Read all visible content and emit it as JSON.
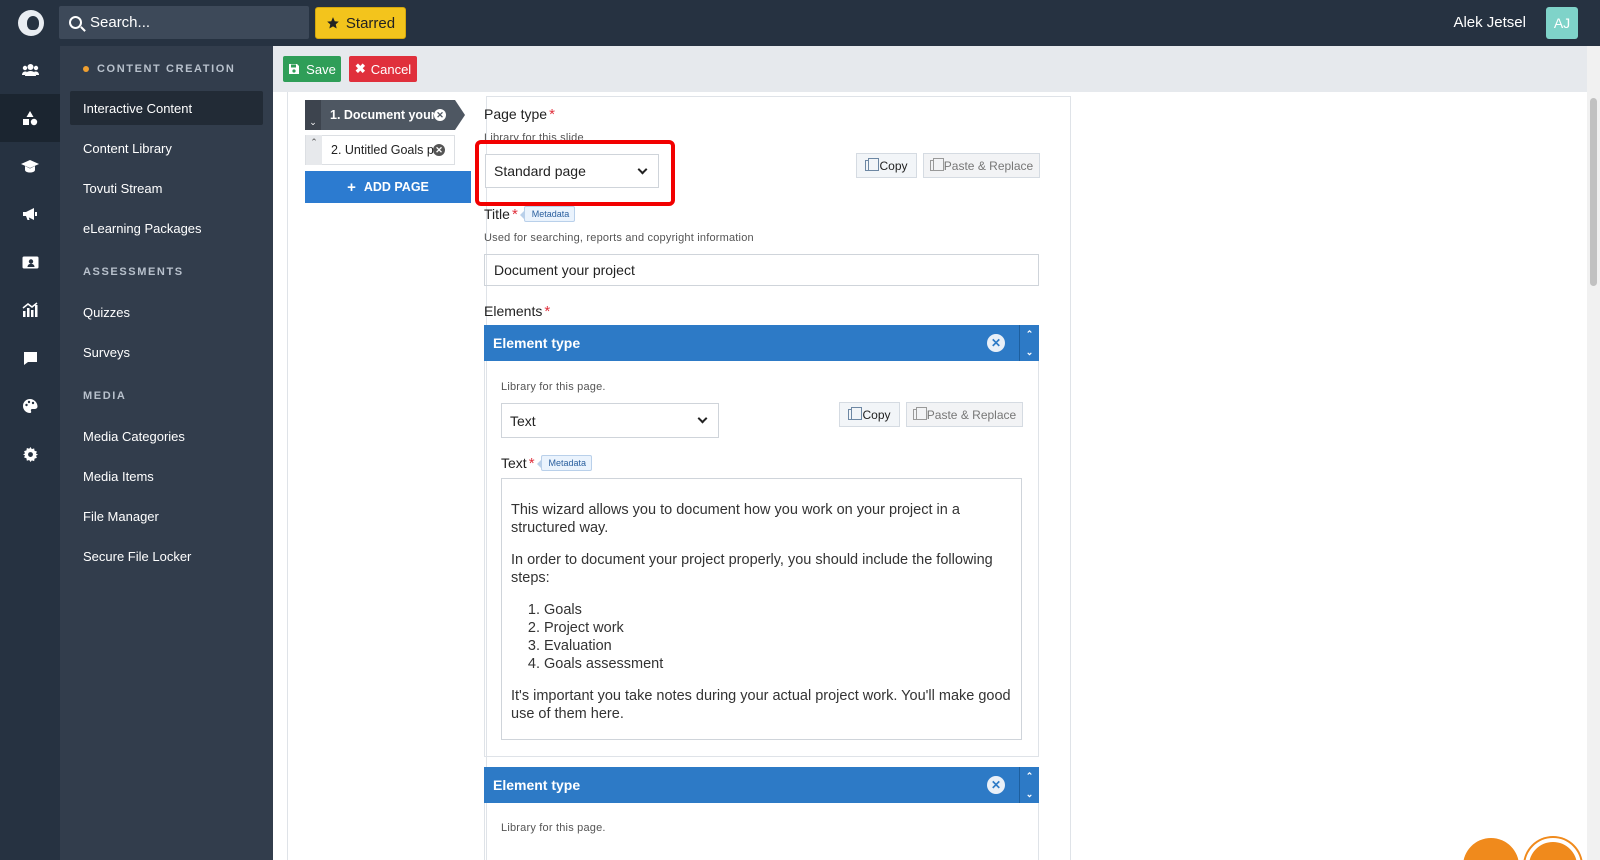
{
  "topbar": {
    "search_placeholder": "Search...",
    "starred_label": "Starred",
    "user_name": "Alek Jetsel",
    "user_initials": "AJ"
  },
  "sidebar": {
    "sections": [
      {
        "heading": "CONTENT CREATION",
        "items": [
          "Interactive Content",
          "Content Library",
          "Tovuti Stream",
          "eLearning Packages"
        ]
      },
      {
        "heading": "ASSESSMENTS",
        "items": [
          "Quizzes",
          "Surveys"
        ]
      },
      {
        "heading": "MEDIA",
        "items": [
          "Media Categories",
          "Media Items",
          "File Manager",
          "Secure File Locker"
        ]
      }
    ],
    "active_item": "Interactive Content"
  },
  "toolbar": {
    "save_label": "Save",
    "cancel_label": "Cancel"
  },
  "pages": {
    "tabs": [
      "1. Document your ...",
      "2. Untitled Goals p..."
    ],
    "add_page_label": "ADD PAGE"
  },
  "form": {
    "page_type": {
      "label": "Page type",
      "hint": "Library for this slide",
      "value": "Standard page",
      "copy_label": "Copy",
      "paste_label": "Paste & Replace"
    },
    "title": {
      "label": "Title",
      "badge": "Metadata",
      "hint": "Used for searching, reports and copyright information",
      "value": "Document your project"
    },
    "elements_label": "Elements",
    "element1": {
      "header": "Element type",
      "hint": "Library for this page.",
      "value": "Text",
      "copy_label": "Copy",
      "paste_label": "Paste & Replace",
      "text_label": "Text",
      "text_badge": "Metadata",
      "paragraph1": "This wizard allows you to document how you work on your project in a structured way.",
      "paragraph2": "In order to document your project properly, you should include the following steps:",
      "steps": [
        "Goals",
        "Project work",
        "Evaluation",
        "Goals assessment"
      ],
      "paragraph3": "It's important you take notes during your actual project work. You'll make good use of them here."
    },
    "element2": {
      "header": "Element type",
      "hint": "Library for this page."
    }
  },
  "colors": {
    "topbar": "#263241",
    "sidebar": "#323d4c",
    "accent_blue": "#2d7ac6",
    "save_green": "#2f9e58",
    "cancel_red": "#e0303c",
    "starred_yellow": "#f3c41c",
    "highlight_red": "#f20000"
  }
}
